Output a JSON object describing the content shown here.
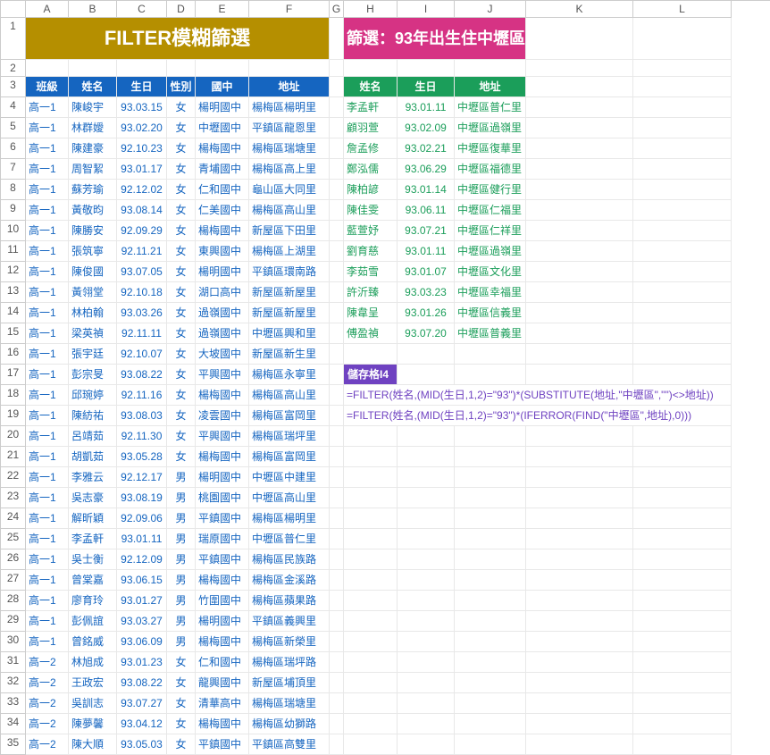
{
  "columns": [
    "",
    "A",
    "B",
    "C",
    "D",
    "E",
    "F",
    "G",
    "H",
    "I",
    "J",
    "K",
    "L"
  ],
  "title_left": "FILTER模糊篩選",
  "title_right": "篩選：93年出生住中壢區",
  "headers_left": [
    "班級",
    "姓名",
    "生日",
    "性別",
    "國中",
    "地址"
  ],
  "headers_right": [
    "姓名",
    "生日",
    "地址"
  ],
  "rows_left": [
    [
      "高一1",
      "陳峻宇",
      "93.03.15",
      "女",
      "楊明國中",
      "楊梅區楊明里"
    ],
    [
      "高一1",
      "林群嬡",
      "93.02.20",
      "女",
      "中壢國中",
      "平鎮區龍恩里"
    ],
    [
      "高一1",
      "陳建豪",
      "92.10.23",
      "女",
      "楊梅國中",
      "楊梅區瑞塘里"
    ],
    [
      "高一1",
      "周智絜",
      "93.01.17",
      "女",
      "青埔國中",
      "楊梅區高上里"
    ],
    [
      "高一1",
      "蘇芳瑜",
      "92.12.02",
      "女",
      "仁和國中",
      "龜山區大同里"
    ],
    [
      "高一1",
      "黃敬昀",
      "93.08.14",
      "女",
      "仁美國中",
      "楊梅區高山里"
    ],
    [
      "高一1",
      "陳勝安",
      "92.09.29",
      "女",
      "楊梅國中",
      "新屋區下田里"
    ],
    [
      "高一1",
      "張筑寧",
      "92.11.21",
      "女",
      "東興國中",
      "楊梅區上湖里"
    ],
    [
      "高一1",
      "陳俊國",
      "93.07.05",
      "女",
      "楊明國中",
      "平鎮區環南路"
    ],
    [
      "高一1",
      "黃翎堂",
      "92.10.18",
      "女",
      "湖口高中",
      "新屋區新屋里"
    ],
    [
      "高一1",
      "林柏翰",
      "93.03.26",
      "女",
      "過嶺國中",
      "新屋區新屋里"
    ],
    [
      "高一1",
      "梁英禎",
      "92.11.11",
      "女",
      "過嶺國中",
      "中壢區興和里"
    ],
    [
      "高一1",
      "張宇廷",
      "92.10.07",
      "女",
      "大坡國中",
      "新屋區新生里"
    ],
    [
      "高一1",
      "彭宗旻",
      "93.08.22",
      "女",
      "平興國中",
      "楊梅區永寧里"
    ],
    [
      "高一1",
      "邱琬婷",
      "92.11.16",
      "女",
      "楊梅國中",
      "楊梅區高山里"
    ],
    [
      "高一1",
      "陳紡祐",
      "93.08.03",
      "女",
      "凌雲國中",
      "楊梅區富岡里"
    ],
    [
      "高一1",
      "呂靖茹",
      "92.11.30",
      "女",
      "平興國中",
      "楊梅區瑞坪里"
    ],
    [
      "高一1",
      "胡凱茹",
      "93.05.28",
      "女",
      "楊梅國中",
      "楊梅區富岡里"
    ],
    [
      "高一1",
      "李雅云",
      "92.12.17",
      "男",
      "楊明國中",
      "中壢區中建里"
    ],
    [
      "高一1",
      "吳志豪",
      "93.08.19",
      "男",
      "桃園國中",
      "中壢區高山里"
    ],
    [
      "高一1",
      "解昕穎",
      "92.09.06",
      "男",
      "平鎮國中",
      "楊梅區楊明里"
    ],
    [
      "高一1",
      "李孟軒",
      "93.01.11",
      "男",
      "瑞原國中",
      "中壢區普仁里"
    ],
    [
      "高一1",
      "吳士衡",
      "92.12.09",
      "男",
      "平鎮國中",
      "楊梅區民族路"
    ],
    [
      "高一1",
      "曾棠嘉",
      "93.06.15",
      "男",
      "楊梅國中",
      "楊梅區金溪路"
    ],
    [
      "高一1",
      "廖育玲",
      "93.01.27",
      "男",
      "竹圍國中",
      "楊梅區蘋果路"
    ],
    [
      "高一1",
      "彭佩誼",
      "93.03.27",
      "男",
      "楊明國中",
      "平鎮區義興里"
    ],
    [
      "高一1",
      "曾銘威",
      "93.06.09",
      "男",
      "楊梅國中",
      "楊梅區新榮里"
    ],
    [
      "高一2",
      "林旭成",
      "93.01.23",
      "女",
      "仁和國中",
      "楊梅區瑞坪路"
    ],
    [
      "高一2",
      "王政宏",
      "93.08.22",
      "女",
      "龍興國中",
      "新屋區埔頂里"
    ],
    [
      "高一2",
      "吳訓志",
      "93.07.27",
      "女",
      "清華高中",
      "楊梅區瑞塘里"
    ],
    [
      "高一2",
      "陳夢馨",
      "93.04.12",
      "女",
      "楊梅國中",
      "楊梅區幼獅路"
    ],
    [
      "高一2",
      "陳大順",
      "93.05.03",
      "女",
      "平鎮國中",
      "平鎮區高雙里"
    ]
  ],
  "rows_right": [
    [
      "李孟軒",
      "93.01.11",
      "中壢區普仁里"
    ],
    [
      "顧羽萱",
      "93.02.09",
      "中壢區過嶺里"
    ],
    [
      "詹孟修",
      "93.02.21",
      "中壢區復華里"
    ],
    [
      "鄭泓儒",
      "93.06.29",
      "中壢區福德里"
    ],
    [
      "陳柏諺",
      "93.01.14",
      "中壢區健行里"
    ],
    [
      "陳佳雯",
      "93.06.11",
      "中壢區仁福里"
    ],
    [
      "藍萱妤",
      "93.07.21",
      "中壢區仁祥里"
    ],
    [
      "劉育慈",
      "93.01.11",
      "中壢區過嶺里"
    ],
    [
      "李茹雪",
      "93.01.07",
      "中壢區文化里"
    ],
    [
      "許沂臻",
      "93.03.23",
      "中壢區幸福里"
    ],
    [
      "陳韋呈",
      "93.01.26",
      "中壢區信義里"
    ],
    [
      "傅盈禎",
      "93.07.20",
      "中壢區普義里"
    ]
  ],
  "i4_label": "儲存格I4",
  "formulas": [
    "=FILTER(姓名,(MID(生日,1,2)=\"93\")*(SUBSTITUTE(地址,\"中壢區\",\"\")<>地址))",
    "=FILTER(姓名,(MID(生日,1,2)=\"93\")*(IFERROR(FIND(\"中壢區\",地址),0)))"
  ]
}
